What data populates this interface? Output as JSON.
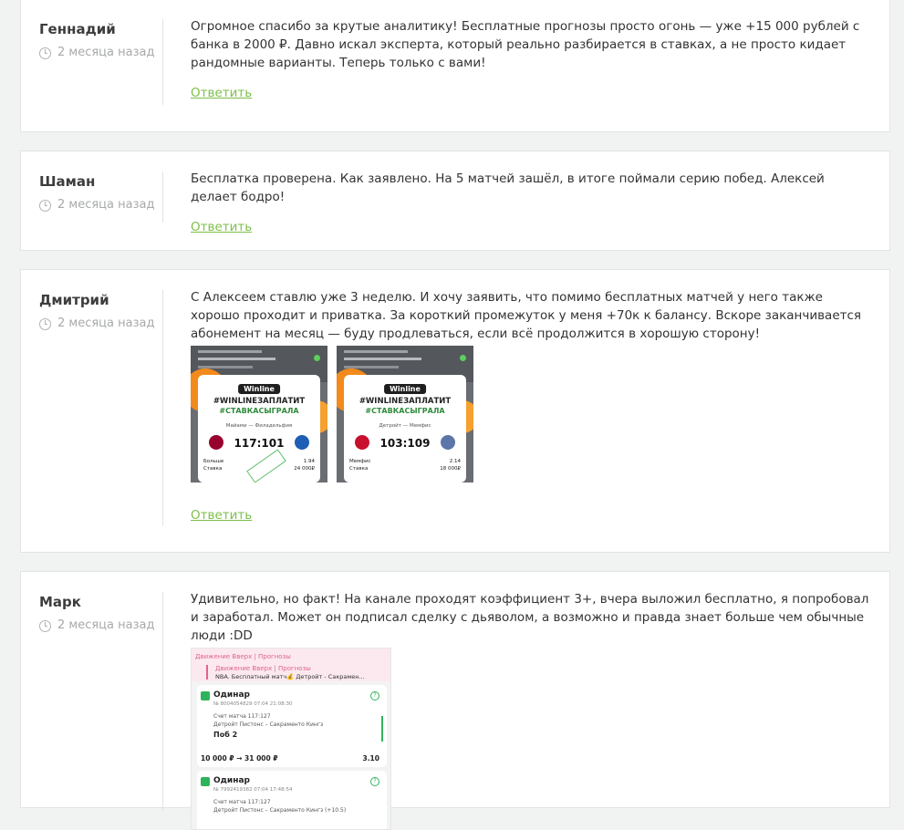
{
  "comments": [
    {
      "author": "Геннадий",
      "date": "2 месяца назад",
      "text": "Огромное спасибо за крутые аналитику! Бесплатные прогнозы просто огонь — уже +15 000 рублей с банка в 2000 ₽. Давно искал эксперта, который реально разбирается в ставках, а не просто кидает рандомные варианты. Теперь только с вами!",
      "reply": "Ответить"
    },
    {
      "author": "Шаман",
      "date": "2 месяца назад",
      "text": "Бесплатка проверена. Как заявлено. На 5 матчей зашёл, в итоге поймали серию побед. Алексей делает бодро!",
      "reply": "Ответить"
    },
    {
      "author": "Дмитрий",
      "date": "2 месяца назад",
      "text": "С Алексеем ставлю уже 3 неделю. И хочу заявить, что помимо бесплатных матчей у него также хорошо проходит и приватка. За короткий промежуток у меня +70к к балансу. Вскоре заканчивается абонемент на месяц — буду продлеваться, если всё продолжится в хорошую сторону!",
      "reply": "Ответить",
      "screenshots": [
        {
          "brand": "Winline",
          "tag1": "#WINLINEЗАПЛАТИТ",
          "tag2": "#СТАВКАСЫГРАЛА",
          "teams": "Майами — Филадельфия",
          "score": "117:101",
          "row1_label": "Больше",
          "row1_value": "1.94",
          "row2_label": "Ставка",
          "row2_value": "24 000₽",
          "logo1_color": "#98002e",
          "logo2_color": "#1d5fb4"
        },
        {
          "brand": "Winline",
          "tag1": "#WINLINEЗАПЛАТИТ",
          "tag2": "#СТАВКАСЫГРАЛА",
          "teams": "Детройт — Мемфис",
          "score": "103:109",
          "row1_label": "Мемфис",
          "row1_value": "2.14",
          "row2_label": "Ставка",
          "row2_value": "18 000₽",
          "logo1_color": "#c8102e",
          "logo2_color": "#5d76a9"
        }
      ]
    },
    {
      "author": "Марк",
      "date": "2 месяца назад",
      "text": "Удивительно, но факт! На канале проходят коэффициент 3+, вчера выложил бесплатно, я попробовал и заработал. Может он подписал сделку с дьяволом, а возможно и правда знает больше чем обычные люди :DD",
      "reply": "Ответить",
      "screenshot": {
        "channel": "Движение Вверх | Прогнозы",
        "channel_quote": "Движение Вверх | Прогнозы",
        "post": "NBA. Бесплатный матч💰 Детройт - Сакрамен...",
        "bets": [
          {
            "title": "Одинар",
            "meta": "№ 8004054829   07:04   21:08:30",
            "score_label": "Счет матча 117:127",
            "match": "Детройт Пистонс – Сакраменто Кингз",
            "pick": "Поб 2",
            "amount": "10 000 ₽ → 31 000 ₽",
            "coef": "3.10"
          },
          {
            "title": "Одинар",
            "meta": "№ 7992419382   07:04   17:48:54",
            "score_label": "Счет матча 117:127",
            "match": "Детройт Пистонс – Сакраменто Кингз (+10.5)"
          }
        ]
      }
    }
  ]
}
